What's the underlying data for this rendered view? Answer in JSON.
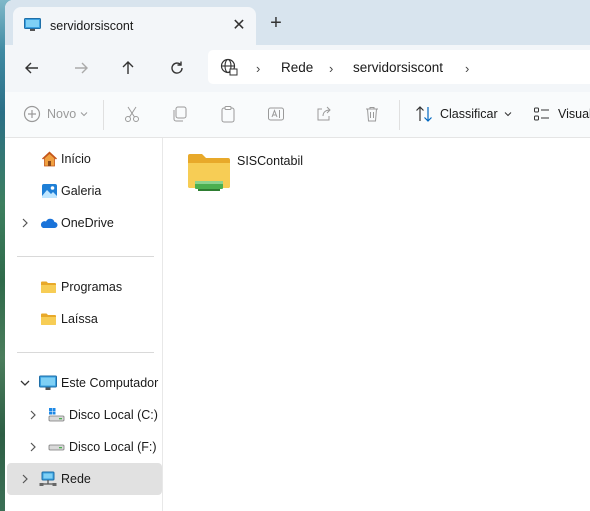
{
  "window": {
    "tab_title": "servidorsiscont",
    "close_glyph": "✕",
    "new_tab_glyph": "+"
  },
  "address": {
    "segments": [
      "Rede",
      "servidorsiscont"
    ]
  },
  "toolbar": {
    "new_label": "Novo",
    "sort_label": "Classificar",
    "view_label": "Visual"
  },
  "sidebar": {
    "items": [
      {
        "label": "Início",
        "icon": "home-icon"
      },
      {
        "label": "Galeria",
        "icon": "gallery-icon"
      },
      {
        "label": "OneDrive",
        "icon": "onedrive-icon"
      },
      {
        "label": "Programas",
        "icon": "folder-icon"
      },
      {
        "label": "Laíssa",
        "icon": "folder-icon"
      },
      {
        "label": "Este Computador",
        "icon": "computer-icon"
      },
      {
        "label": "Disco Local (C:)",
        "icon": "drive-c-icon"
      },
      {
        "label": "Disco Local (F:)",
        "icon": "drive-icon"
      },
      {
        "label": "Rede",
        "icon": "network-icon"
      }
    ]
  },
  "content": {
    "items": [
      {
        "label": "SISContabil",
        "icon": "network-share-folder-icon"
      }
    ]
  },
  "colors": {
    "accent": "#0067c0",
    "folder": "#f5c748",
    "share_green": "#4caf50",
    "selected_bg": "#e1e1e1"
  }
}
